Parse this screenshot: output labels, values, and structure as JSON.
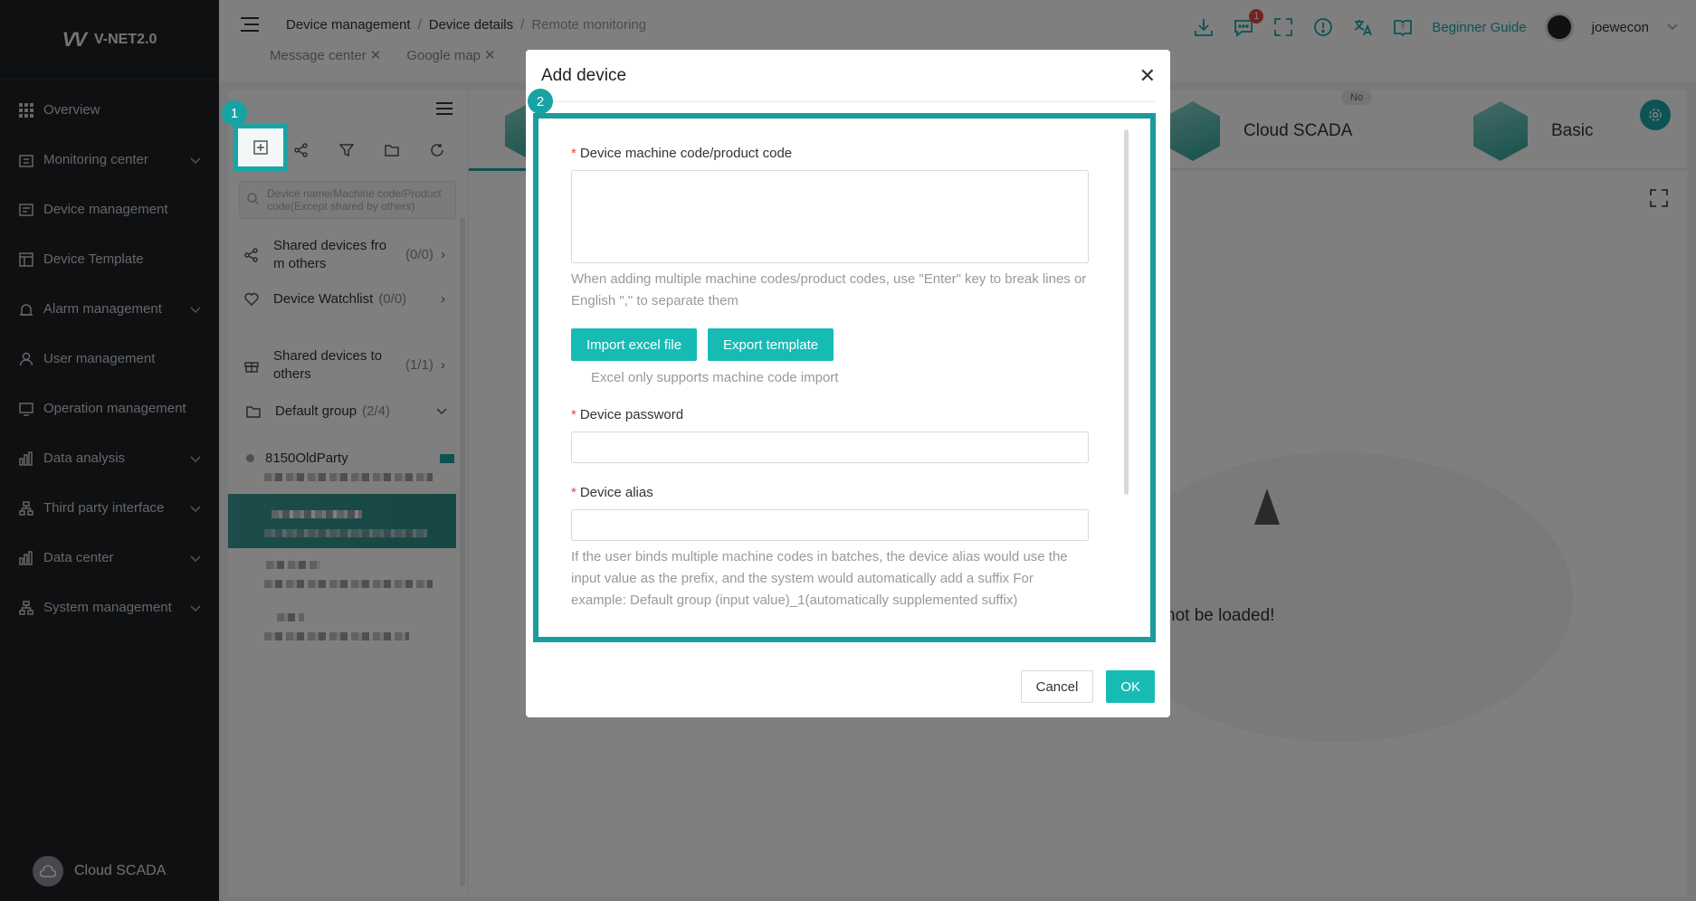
{
  "sidebar": {
    "logo_mark": "VV",
    "app_name": "V-NET2.0",
    "items": [
      {
        "label": "Overview"
      },
      {
        "label": "Monitoring center"
      },
      {
        "label": "Device management"
      },
      {
        "label": "Device Template"
      },
      {
        "label": "Alarm management"
      },
      {
        "label": "User management"
      },
      {
        "label": "Operation management"
      },
      {
        "label": "Data analysis"
      },
      {
        "label": "Third party interface"
      },
      {
        "label": "Data center"
      },
      {
        "label": "System management"
      }
    ],
    "footer_label": "Cloud SCADA"
  },
  "header": {
    "breadcrumb": [
      "Device management",
      "Device details",
      "Remote monitoring"
    ],
    "tabs": [
      "Message center",
      "Google map"
    ],
    "notification_count": "1",
    "guide": "Beginner Guide",
    "username": "joewecon"
  },
  "device_panel": {
    "search_placeholder": "Device name/Machine code/Product code(Except shared by others)",
    "shared_from_line1": "Shared devices fro",
    "shared_from_line2": "m others",
    "shared_from_count": "(0/0)",
    "watchlist": "Device Watchlist",
    "watchlist_count": "(0/0)",
    "shared_to_line1": "Shared devices to",
    "shared_to_line2": "others",
    "shared_to_count": "(1/1)",
    "group": "Default group",
    "group_count": "(2/4)",
    "device1": "8150OldParty"
  },
  "main": {
    "cloud_scada": "Cloud SCADA",
    "no_pill": "No",
    "basic": "Basic",
    "error_text": "not be loaded!"
  },
  "modal": {
    "title": "Add device",
    "machine_code_label": "Device machine code/product code",
    "machine_code_hint": "When adding multiple machine codes/product codes, use \"Enter\" key to break lines or English \",\" to separate them",
    "import_btn": "Import excel file",
    "export_btn": "Export template",
    "excel_note": "Excel only supports machine code import",
    "password_label": "Device password",
    "alias_label": "Device alias",
    "alias_hint": "If the user binds multiple machine codes in batches, the device alias would use the input value as the prefix, and the system would automatically add a suffix For example: Default group (input value)_1(automatically supplemented suffix)",
    "cancel": "Cancel",
    "ok": "OK"
  },
  "steps": {
    "one": "1",
    "two": "2"
  },
  "colors": {
    "accent": "#16bcb4",
    "sidebar": "#1c2024",
    "highlight": "#1a9c9c"
  }
}
